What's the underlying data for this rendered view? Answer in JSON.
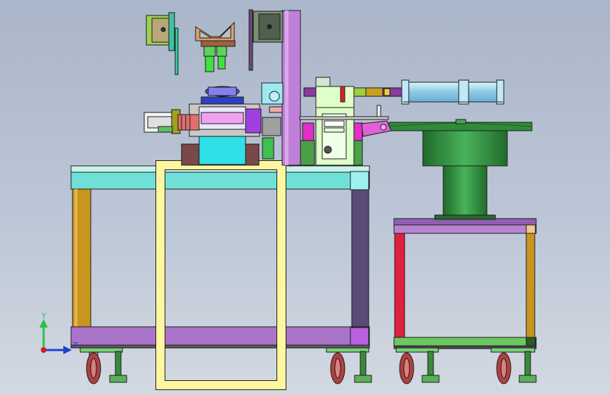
{
  "viewport": {
    "background_top": "#aab6c9",
    "background_bottom": "#d3d9e2"
  },
  "triad": {
    "y_label": "Y",
    "z_label": "Z",
    "y_color": "#2fbf4a",
    "z_color": "#1f3fd0",
    "origin_color": "#d02020"
  },
  "colors": {
    "outline": "#1c1c1c",
    "table_top": "#bff0e6",
    "beam_cyan": "#6fe0d8",
    "beam_purple": "#a974c8",
    "leg_gold": "#c8961e",
    "leg_slate": "#5a4a78",
    "yellow_frame": "#fff6a0",
    "bowl_green": "#2e8b3a",
    "cylinder_blue": "#a8dcf0",
    "caster_red": "#b04040",
    "magenta": "#e040d0",
    "cyan_block": "#30e0e8",
    "lavender_column": "#c080d8"
  }
}
